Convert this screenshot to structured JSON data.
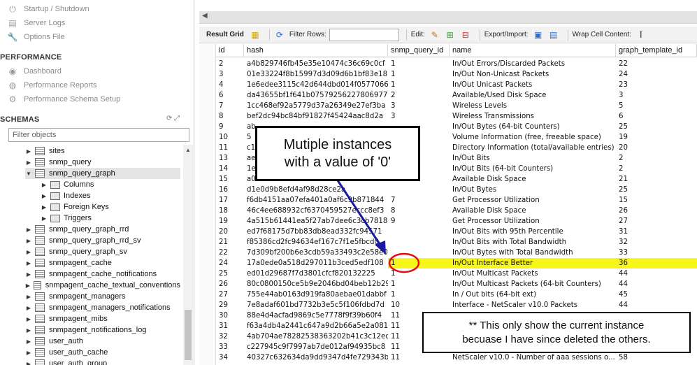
{
  "navigator": {
    "management_items": [
      {
        "label": "Startup / Shutdown",
        "icon": "power-icon"
      },
      {
        "label": "Server Logs",
        "icon": "log-icon"
      },
      {
        "label": "Options File",
        "icon": "wrench-icon"
      }
    ],
    "performance_title": "PERFORMANCE",
    "performance_items": [
      {
        "label": "Dashboard",
        "icon": "dashboard-icon"
      },
      {
        "label": "Performance Reports",
        "icon": "reports-icon"
      },
      {
        "label": "Performance Schema Setup",
        "icon": "settings-icon"
      }
    ],
    "schemas_title": "SCHEMAS",
    "filter_placeholder": "Filter objects",
    "tree": [
      {
        "label": "sites",
        "expanded": false
      },
      {
        "label": "snmp_query",
        "expanded": false
      },
      {
        "label": "snmp_query_graph",
        "expanded": true,
        "selected": true
      },
      {
        "label": "Columns",
        "child": true
      },
      {
        "label": "Indexes",
        "child": true
      },
      {
        "label": "Foreign Keys",
        "child": true
      },
      {
        "label": "Triggers",
        "child": true
      },
      {
        "label": "snmp_query_graph_rrd",
        "expanded": false
      },
      {
        "label": "snmp_query_graph_rrd_sv",
        "expanded": false
      },
      {
        "label": "snmp_query_graph_sv",
        "expanded": false
      },
      {
        "label": "snmpagent_cache",
        "expanded": false
      },
      {
        "label": "snmpagent_cache_notifications",
        "expanded": false
      },
      {
        "label": "snmpagent_cache_textual_conventions",
        "expanded": false
      },
      {
        "label": "snmpagent_managers",
        "expanded": false
      },
      {
        "label": "snmpagent_managers_notifications",
        "expanded": false
      },
      {
        "label": "snmpagent_mibs",
        "expanded": false
      },
      {
        "label": "snmpagent_notifications_log",
        "expanded": false
      },
      {
        "label": "user_auth",
        "expanded": false
      },
      {
        "label": "user_auth_cache",
        "expanded": false
      },
      {
        "label": "user_auth_group",
        "expanded": false
      }
    ]
  },
  "toolbar": {
    "result_grid": "Result Grid",
    "filter_rows": "Filter Rows:",
    "filter_value": "",
    "edit": "Edit:",
    "export_import": "Export/Import:",
    "wrap_cell": "Wrap Cell Content:"
  },
  "grid": {
    "columns": [
      "id",
      "hash",
      "snmp_query_id",
      "name",
      "graph_template_id"
    ],
    "rows": [
      [
        "2",
        "a4b829746fb45e35e10474c36c69c0cf",
        "1",
        "In/Out Errors/Discarded Packets",
        "22"
      ],
      [
        "3",
        "01e33224f8b15997d3d09d6b1bf83e18",
        "1",
        "In/Out Non-Unicast Packets",
        "24"
      ],
      [
        "4",
        "1e6edee3115c42d644dbd014f0577066",
        "1",
        "In/Out Unicast Packets",
        "23"
      ],
      [
        "6",
        "da43655bf1f641b07579256227806977",
        "2",
        "Available/Used Disk Space",
        "3"
      ],
      [
        "7",
        "1cc468ef92a5779d37a26349e27ef3ba",
        "3",
        "Wireless Levels",
        "5"
      ],
      [
        "8",
        "bef2dc94bc84bf91827f45424aac8d2a",
        "3",
        "Wireless Transmissions",
        "6"
      ],
      [
        "9",
        "ab",
        "",
        "In/Out Bytes (64-bit Counters)",
        "25"
      ],
      [
        "10",
        "5",
        "",
        "Volume Information (free, freeable space)",
        "19"
      ],
      [
        "11",
        "c1",
        "",
        "Directory Information (total/available entries)",
        "20"
      ],
      [
        "13",
        "ae",
        "",
        "In/Out Bits",
        "2"
      ],
      [
        "14",
        "1e",
        "",
        "In/Out Bits (64-bit Counters)",
        "2"
      ],
      [
        "15",
        "a0",
        "",
        "Available Disk Space",
        "21"
      ],
      [
        "16",
        "d1e0d9b8efd4af98d28ce2a",
        "",
        "In/Out Bytes",
        "25"
      ],
      [
        "17",
        "f6db4151aa07efa401a0af6c9b871844",
        "7",
        "Get Processor Utilization",
        "15"
      ],
      [
        "18",
        "46c4ee688932cf6370459527eccc8ef3",
        "8",
        "Available Disk Space",
        "26"
      ],
      [
        "19",
        "4a515b61441ea5f27ab7dee6c3cb7818",
        "9",
        "Get Processor Utilization",
        "27"
      ],
      [
        "20",
        "ed7f68175d7bb83db8ead332fc94571",
        "",
        "In/Out Bits with 95th Percentile",
        "31"
      ],
      [
        "21",
        "f85386cd2fc94634ef167c7f1e5fbcd0",
        "",
        "In/Out Bits with Total Bandwidth",
        "32"
      ],
      [
        "22",
        "7d309bf200b6e3cdb59a33493c2e58e0",
        "",
        "In/Out Bytes with Total Bandwidth",
        "33"
      ],
      [
        "24",
        "17a0ede0a518d297011b3ced5edf108",
        "1",
        "In/Out Interface Better",
        "36"
      ],
      [
        "25",
        "ed01d29687f7d3801cfcf820132225",
        "1",
        "In/Out Multicast Packets",
        "44"
      ],
      [
        "26",
        "80c0800150ce5b9e2046bd04beb12b29",
        "1",
        "In/Out Multicast Packets (64-bit Counters)",
        "44"
      ],
      [
        "27",
        "755e44ab0163d919fa80aebae01dabbf",
        "1",
        "In / Out bits (64-bit ext)",
        "45"
      ],
      [
        "29",
        "7e8adaf601bd7732b3e5c5f106fdbd7d",
        "10",
        "Interface - NetScaler v10.0 Packets",
        "44"
      ],
      [
        "30",
        "88e4d4acfad9869c5e7778f9f39b60f4",
        "11",
        "",
        ""
      ],
      [
        "31",
        "f63a4db4a2441c647a9d2b66a5e2a081",
        "11",
        "",
        ""
      ],
      [
        "32",
        "4ab704ae78282538363202b41c3c12ec",
        "11",
        "",
        ""
      ],
      [
        "33",
        "c227945c9f7997ab7de012af94935bc8",
        "11",
        "",
        ""
      ],
      [
        "34",
        "40327c632634da9dd9347d4fe729343b",
        "11",
        "NetScaler v10.0 - Number of aaa sessions o...",
        "58"
      ]
    ],
    "highlight_row": 19
  },
  "annotations": {
    "callout1": [
      "Mutiple instances",
      "with a value of '0'"
    ],
    "callout2": [
      "** This only show the current instance",
      "becuase I have since deleted the others."
    ],
    "arrow_color": "#1a1aa0",
    "circle_color": "#e01010",
    "highlight_color": "#f6f61c"
  }
}
